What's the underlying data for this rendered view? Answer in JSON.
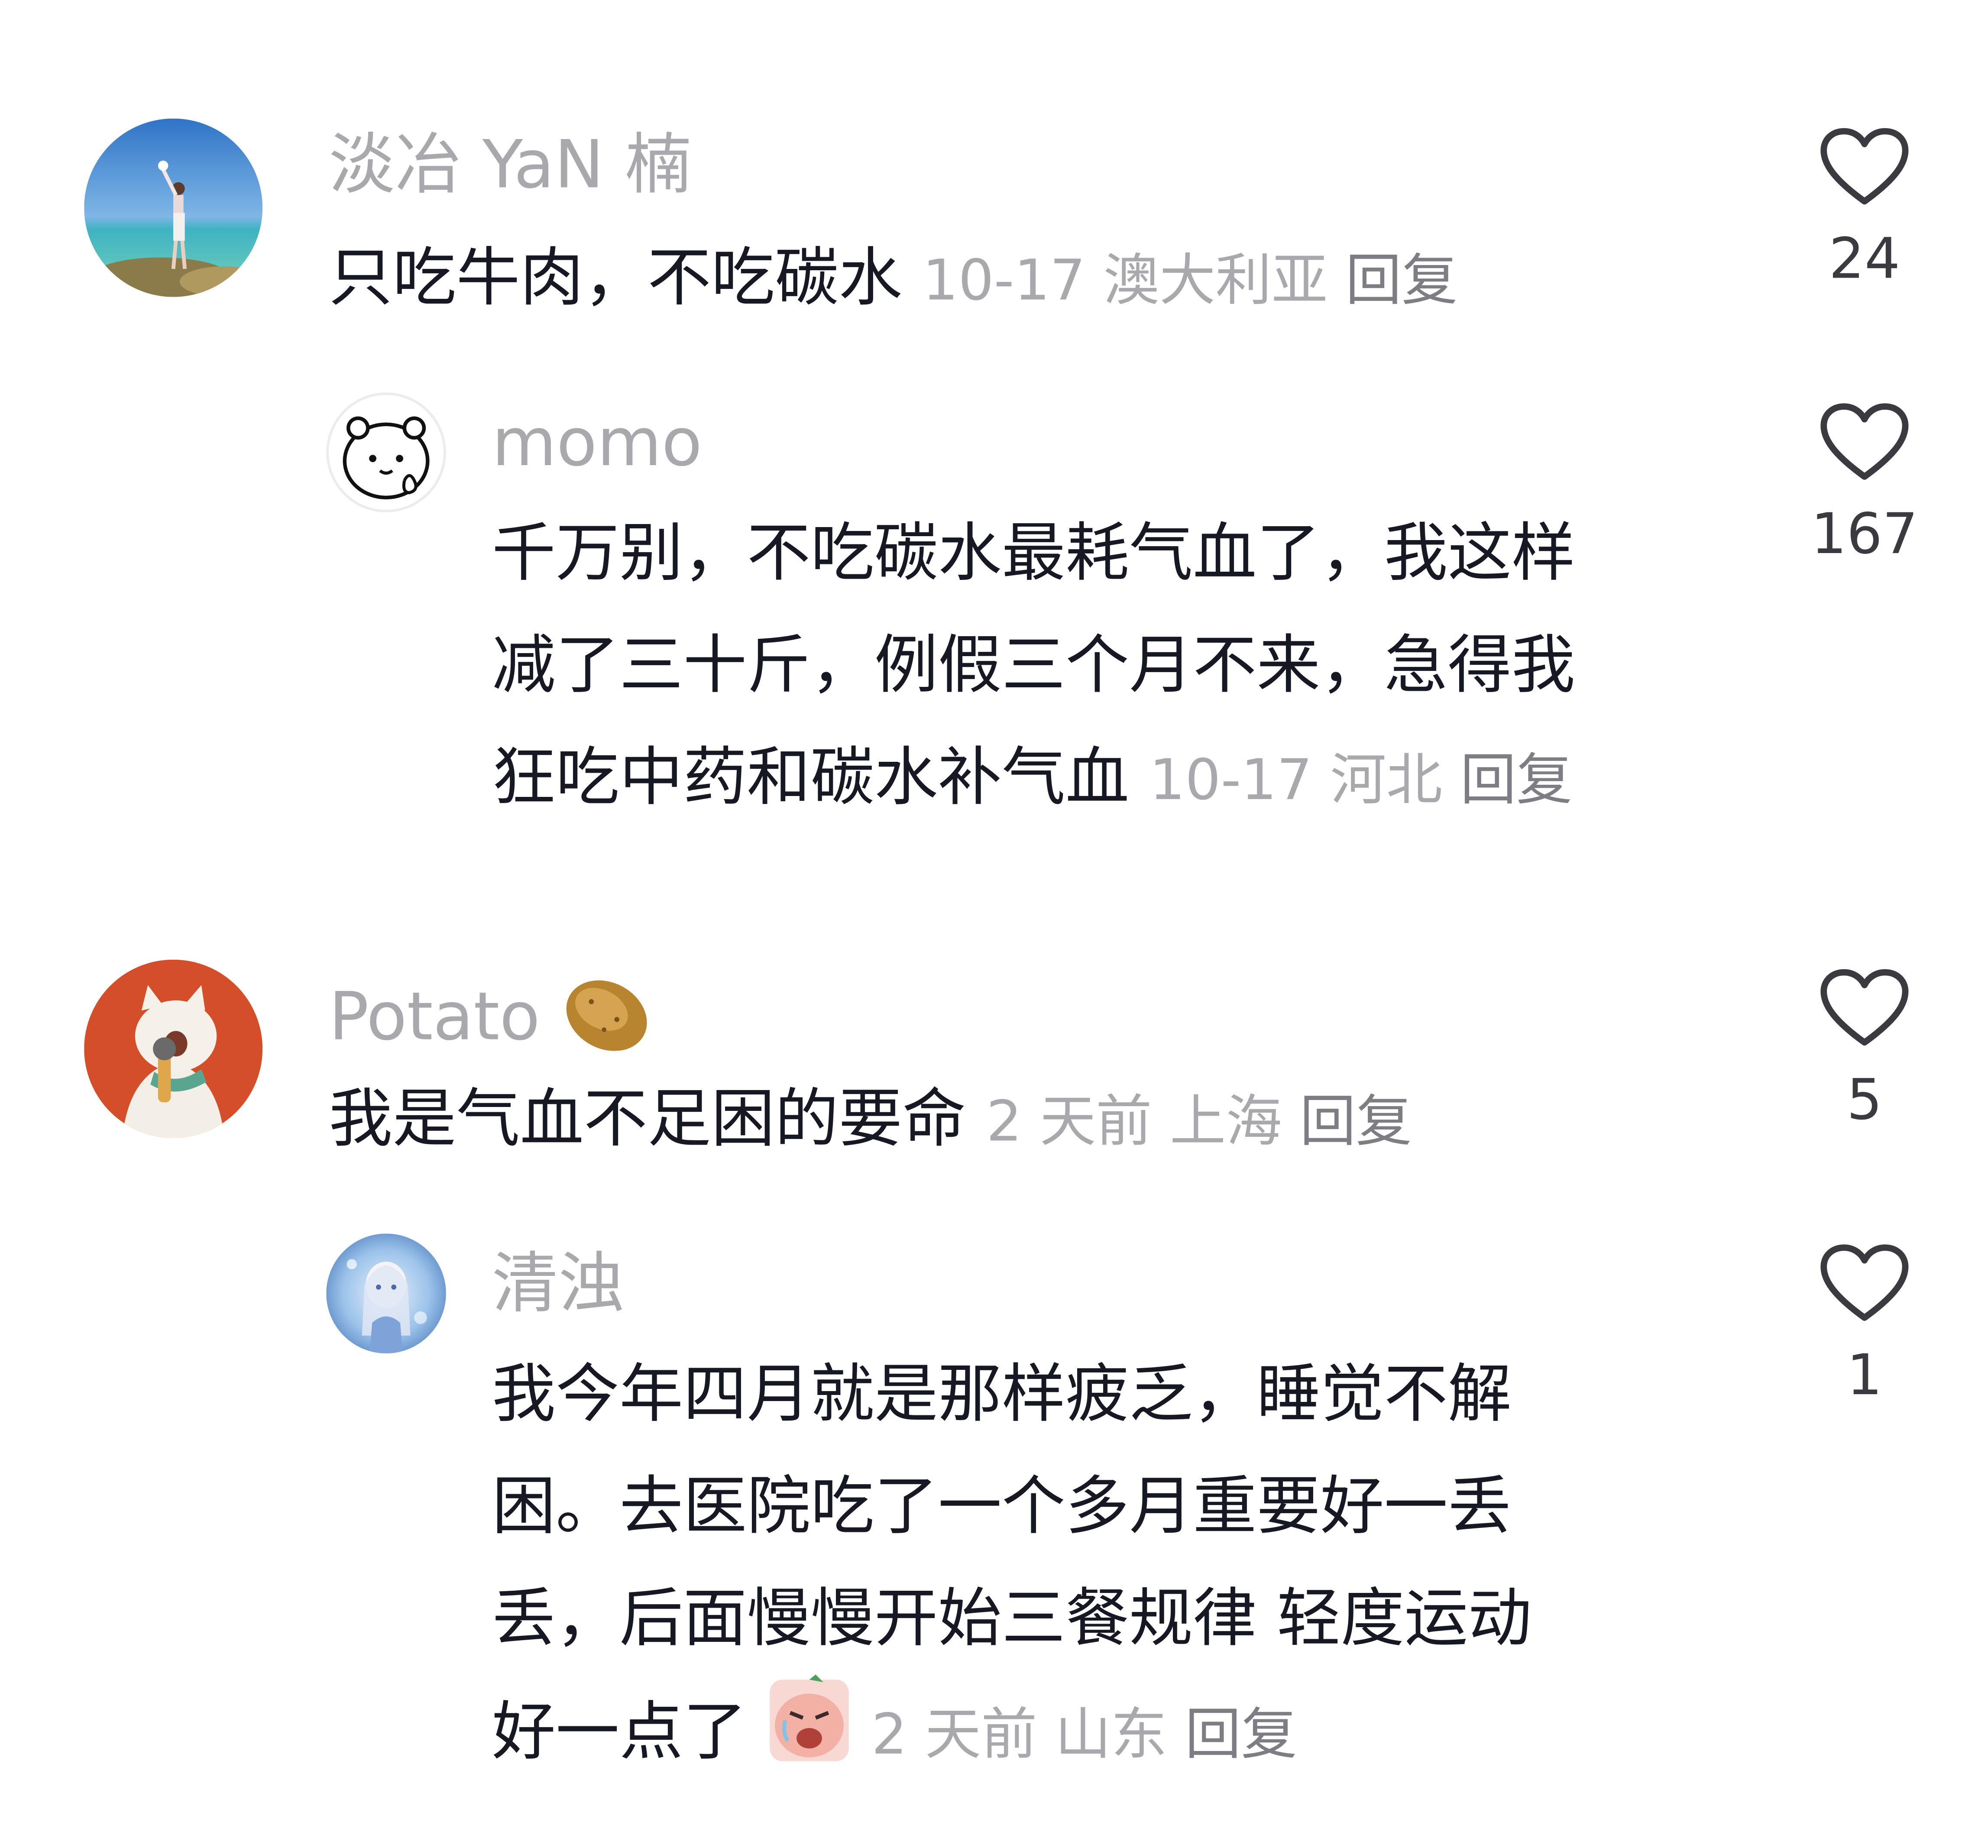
{
  "comments": [
    {
      "username": "淡冶 YaN 楠",
      "text": "只吃牛肉，不吃碳水",
      "date": "10-17",
      "location": "澳大利亚",
      "reply_label": "回复",
      "likes": "24",
      "avatar": "beach-photo-avatar",
      "replies": [
        {
          "username": "momo",
          "text_lines": [
            "千万别，不吃碳水最耗气血了，我这样",
            "减了三十斤，例假三个月不来，急得我",
            "狂吃中药和碳水补气血"
          ],
          "date": "10-17",
          "location": "河北",
          "reply_label": "回复",
          "likes": "167",
          "avatar": "cartoon-bear-avatar"
        }
      ]
    },
    {
      "username": "Potato",
      "username_emoji": "potato-emoji",
      "text": "我是气血不足困的要命",
      "date": "2 天前",
      "location": "上海",
      "reply_label": "回复",
      "likes": "5",
      "avatar": "cat-with-microphone-avatar",
      "replies": [
        {
          "username": "清浊",
          "text_lines": [
            "我今年四月就是那样疲乏，睡觉不解",
            "困。去医院吃了一个多月重要好一丢",
            "丢，后面慢慢开始三餐规律 轻度运动",
            "好一点了"
          ],
          "text_emoji": "crying-face-sticker",
          "date": "2 天前",
          "location": "山东",
          "reply_label": "回复",
          "likes": "1",
          "avatar": "anime-girl-avatar"
        }
      ]
    }
  ],
  "colors": {
    "text_primary": "#161823",
    "text_secondary": "#a8a8ad",
    "icon_stroke": "#3a3a40",
    "background": "#ffffff"
  }
}
